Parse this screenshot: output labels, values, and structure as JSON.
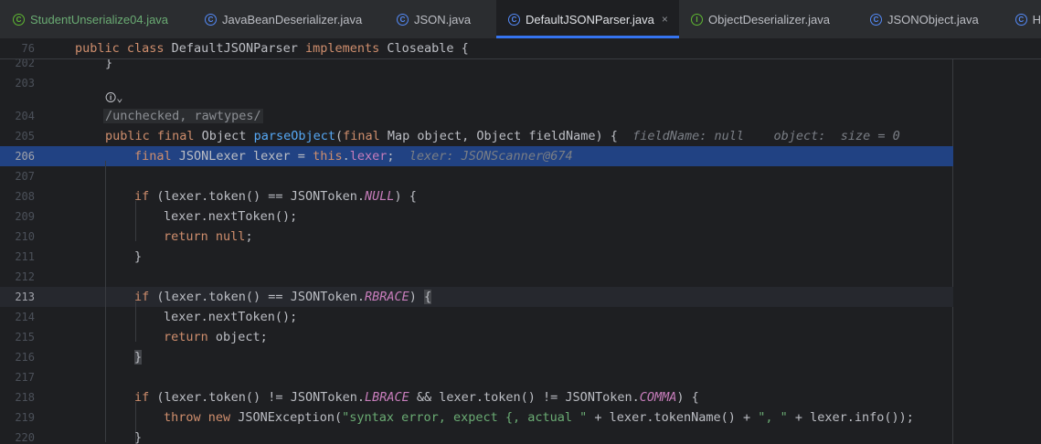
{
  "tabs": [
    {
      "label": "StudentUnserialize04.java",
      "active": false
    },
    {
      "label": "JavaBeanDeserializer.java",
      "active": false
    },
    {
      "label": "JSON.java",
      "active": false
    },
    {
      "label": "DefaultJSONParser.java",
      "active": true,
      "close": "×"
    },
    {
      "label": "ObjectDeserializer.java",
      "active": false
    },
    {
      "label": "JSONObject.java",
      "active": false
    },
    {
      "label": "H",
      "active": false
    }
  ],
  "sticky": {
    "line_no": "76",
    "code_kw": "public class",
    "code_cls": " DefaultJSONParser ",
    "code_kw2": "implements",
    "code_rest": " Closeable {"
  },
  "lines": {
    "l202": {
      "no": "202",
      "text": "}"
    },
    "l203": {
      "no": "203"
    },
    "inlay": "🛈⌄",
    "l204": {
      "no": "204",
      "text": "/unchecked, rawtypes/"
    },
    "l205": {
      "no": "205",
      "p1": "public final",
      "p2": " Object ",
      "p3": "parseObject",
      "p4": "(",
      "p5": "final",
      "p6": " Map object, Object fieldName) {",
      "hint": "  fieldName: null    object:  size = 0"
    },
    "l206": {
      "no": "206",
      "p1": "final",
      "p2": " JSONLexer lexer = ",
      "p3": "this",
      "p4": ".",
      "p5": "lexer",
      "p6": ";",
      "hint": "  lexer: JSONScanner@674"
    },
    "l207": {
      "no": "207"
    },
    "l208": {
      "no": "208",
      "p1": "if",
      "p2": " (lexer.token() == JSONToken.",
      "p3": "NULL",
      "p4": ") {"
    },
    "l209": {
      "no": "209",
      "text": "lexer.nextToken();"
    },
    "l210": {
      "no": "210",
      "p1": "return",
      "p2": " ",
      "p3": "null",
      "p4": ";"
    },
    "l211": {
      "no": "211",
      "text": "}"
    },
    "l212": {
      "no": "212"
    },
    "l213": {
      "no": "213",
      "p1": "if",
      "p2": " (lexer.token() == JSONToken.",
      "p3": "RBRACE",
      "p4": ") ",
      "p5": "{"
    },
    "l214": {
      "no": "214",
      "text": "lexer.nextToken();"
    },
    "l215": {
      "no": "215",
      "p1": "return",
      "p2": " object;"
    },
    "l216": {
      "no": "216",
      "text": "}"
    },
    "l217": {
      "no": "217"
    },
    "l218": {
      "no": "218",
      "p1": "if",
      "p2": " (lexer.token() != JSONToken.",
      "p3": "LBRACE",
      "p4": " && lexer.token() != JSONToken.",
      "p5": "COMMA",
      "p6": ") {"
    },
    "l219": {
      "no": "219",
      "p1": "throw new",
      "p2": " JSONException(",
      "p3": "\"syntax error, expect {, actual \"",
      "p4": " + lexer.tokenName() + ",
      "p5": "\", \"",
      "p6": " + lexer.info());"
    },
    "l220": {
      "no": "220",
      "text": "}"
    }
  },
  "colors": {
    "selection": "#214283",
    "current_line": "#26282e",
    "accent": "#3574f0"
  }
}
